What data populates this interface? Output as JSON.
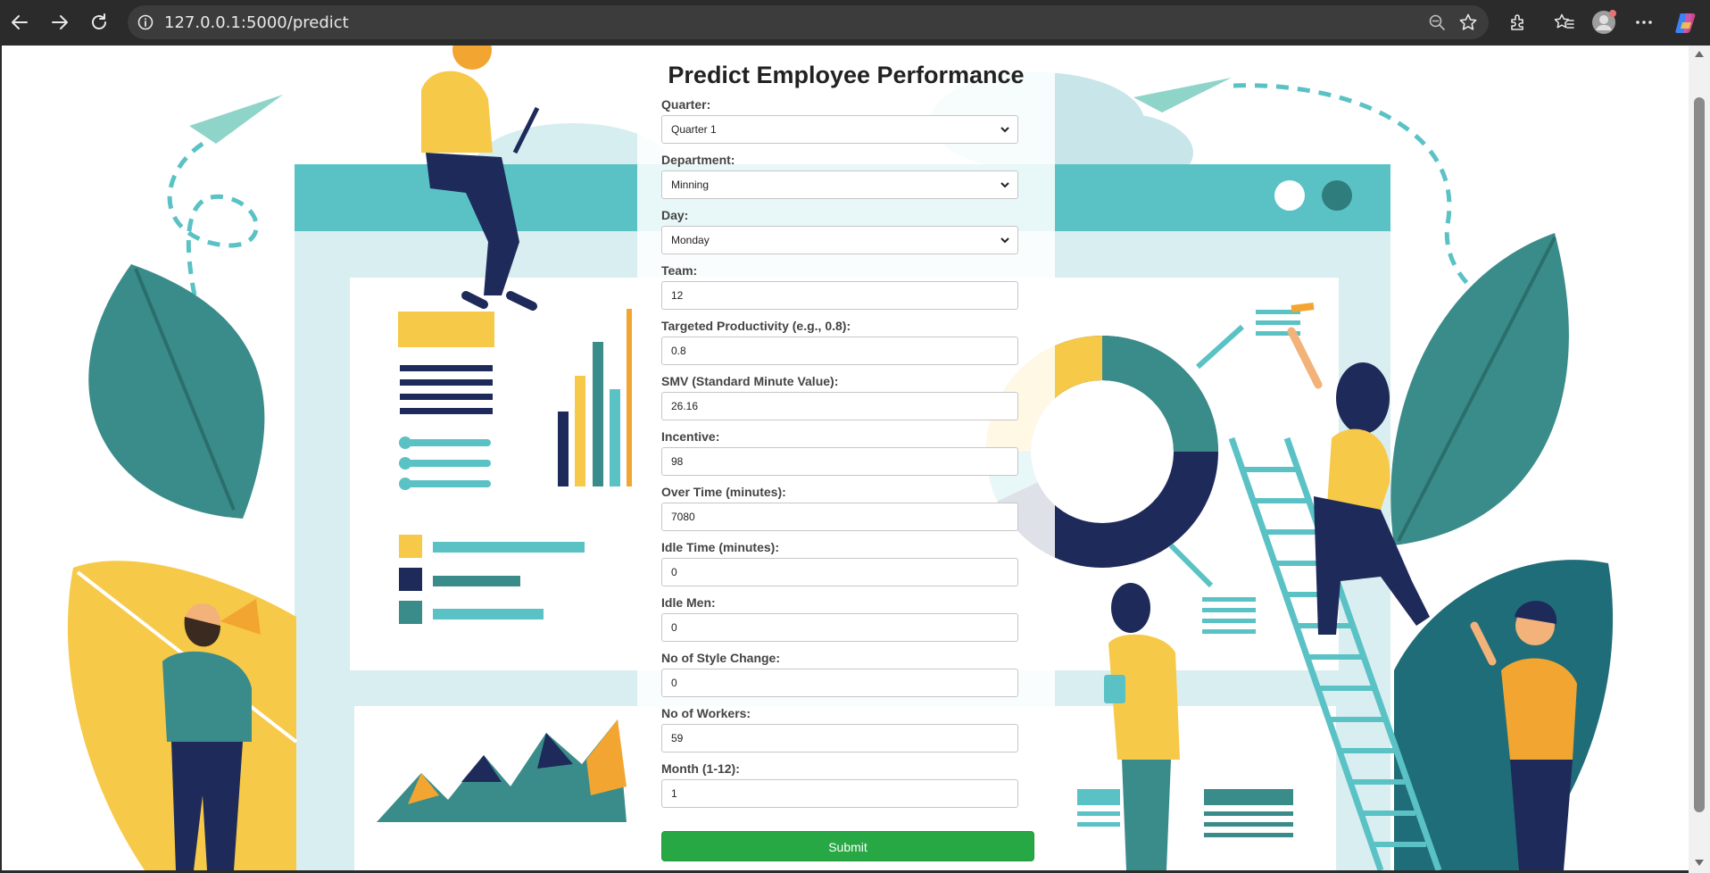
{
  "browser": {
    "url": "127.0.0.1:5000/predict"
  },
  "icons": [
    "back-icon",
    "forward-icon",
    "reload-icon",
    "site-info-icon",
    "zoom-out-icon",
    "favorite-star-icon",
    "extensions-icon",
    "favorites-icon",
    "profile-avatar-icon",
    "more-icon",
    "copilot-icon"
  ],
  "form": {
    "title": "Predict Employee Performance",
    "fields": [
      {
        "label": "Quarter:",
        "value": "Quarter 1",
        "type": "select"
      },
      {
        "label": "Department:",
        "value": "Minning",
        "type": "select"
      },
      {
        "label": "Day:",
        "value": "Monday",
        "type": "select"
      },
      {
        "label": "Team:",
        "value": "12",
        "type": "input"
      },
      {
        "label": "Targeted Productivity (e.g., 0.8):",
        "value": "0.8",
        "type": "input"
      },
      {
        "label": "SMV (Standard Minute Value):",
        "value": "26.16",
        "type": "input"
      },
      {
        "label": "Incentive:",
        "value": "98",
        "type": "input"
      },
      {
        "label": "Over Time (minutes):",
        "value": "7080",
        "type": "input"
      },
      {
        "label": "Idle Time (minutes):",
        "value": "0",
        "type": "input"
      },
      {
        "label": "Idle Men:",
        "value": "0",
        "type": "input"
      },
      {
        "label": "No of Style Change:",
        "value": "0",
        "type": "input"
      },
      {
        "label": "No of Workers:",
        "value": "59",
        "type": "input"
      },
      {
        "label": "Month (1-12):",
        "value": "1",
        "type": "input"
      }
    ],
    "submit_label": "Submit",
    "submit_color": "#28a745"
  },
  "colors": {
    "teal": "#5ac2c5",
    "dark_teal": "#3a8c8a",
    "navy": "#1e2a5a",
    "yellow": "#f7c948",
    "orange": "#f2a531"
  }
}
